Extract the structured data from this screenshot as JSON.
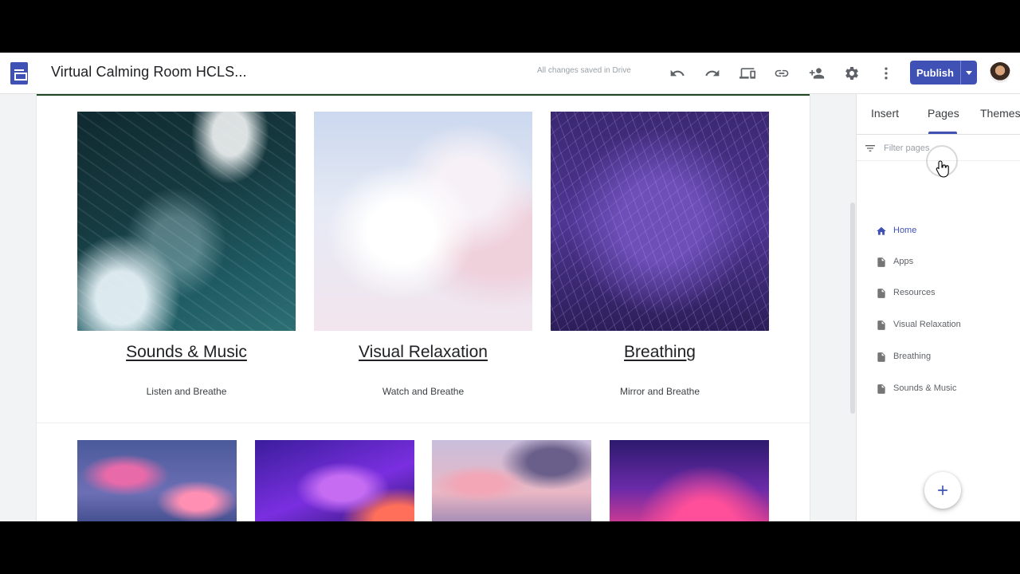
{
  "app": {
    "doc_title": "Virtual Calming Room HCLS...",
    "save_status": "All changes saved in Drive"
  },
  "toolbar": {
    "icons": [
      "undo-icon",
      "redo-icon",
      "preview-icon",
      "link-icon",
      "share-icon",
      "settings-icon",
      "more-icon"
    ],
    "publish_label": "Publish"
  },
  "canvas": {
    "tiles": [
      {
        "heading": "Sounds & Music",
        "subtitle": "Listen and Breathe"
      },
      {
        "heading": "Visual Relaxation",
        "subtitle": "Watch and Breathe"
      },
      {
        "heading": "Breathing",
        "subtitle": "Mirror and Breathe"
      }
    ]
  },
  "panel": {
    "tabs": [
      {
        "label": "Insert"
      },
      {
        "label": "Pages"
      },
      {
        "label": "Themes"
      }
    ],
    "active_tab": "Pages",
    "filter_placeholder": "Filter pages",
    "pages": [
      {
        "label": "Home",
        "icon": "home-icon"
      },
      {
        "label": "Apps",
        "icon": "page-icon"
      },
      {
        "label": "Resources",
        "icon": "page-icon"
      },
      {
        "label": "Visual Relaxation",
        "icon": "page-icon"
      },
      {
        "label": "Breathing",
        "icon": "page-icon"
      },
      {
        "label": "Sounds & Music",
        "icon": "page-icon"
      }
    ],
    "add_button_icon": "plus-icon"
  },
  "colors": {
    "accent": "#3f51b5",
    "header_line": "#1e4620"
  }
}
